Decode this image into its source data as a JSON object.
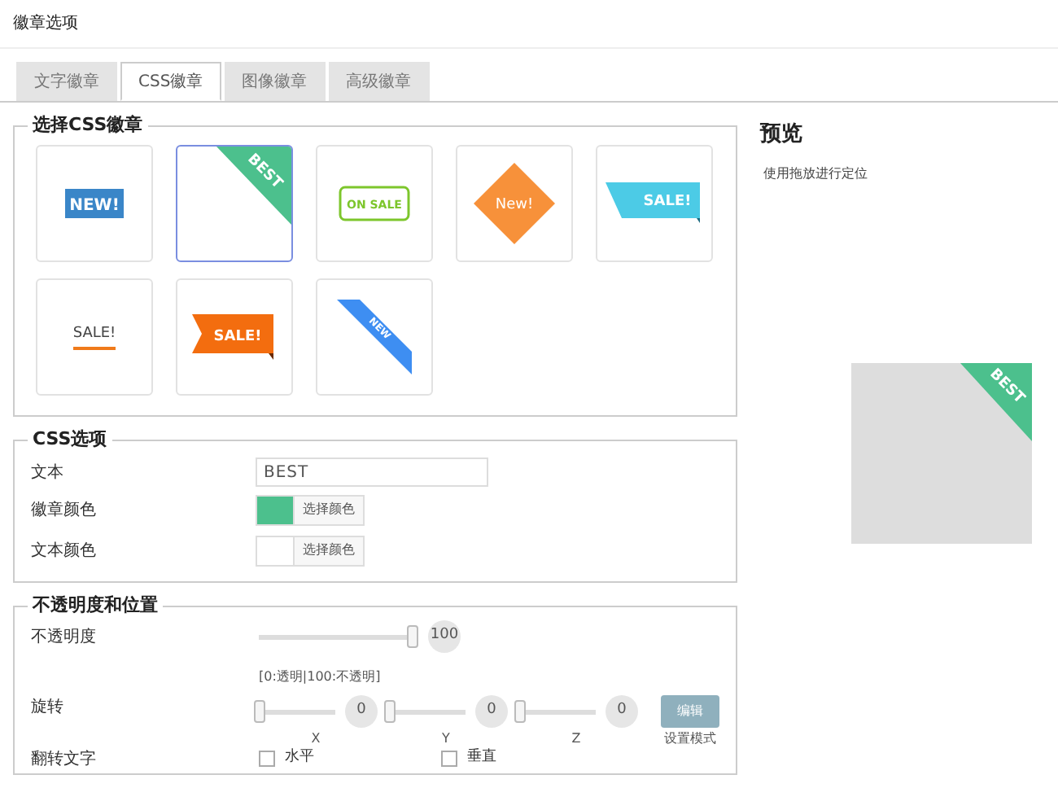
{
  "title": "徽章选项",
  "tabs": [
    {
      "label": "文字徽章",
      "selected": false
    },
    {
      "label": "CSS徽章",
      "selected": true
    },
    {
      "label": "图像徽章",
      "selected": false
    },
    {
      "label": "高级徽章",
      "selected": false
    }
  ],
  "badge_section": {
    "legend": "选择CSS徽章",
    "badges": [
      {
        "kind": "rect",
        "text": "NEW!",
        "color": "#3a86c8",
        "selected": false
      },
      {
        "kind": "corner",
        "text": "BEST",
        "color": "#4cc08d",
        "selected": true
      },
      {
        "kind": "outline",
        "text": "ON SALE",
        "color": "#7dc62c",
        "selected": false
      },
      {
        "kind": "diamond",
        "text": "New!",
        "color": "#f7913a",
        "selected": false
      },
      {
        "kind": "flag",
        "text": "SALE!",
        "color": "#4ccbe6",
        "selected": false
      },
      {
        "kind": "underline",
        "text": "SALE!",
        "color": "#f07a1a",
        "selected": false
      },
      {
        "kind": "arrow",
        "text": "SALE!",
        "color": "#f36d0f",
        "selected": false
      },
      {
        "kind": "ribbon",
        "text": "NEW",
        "color": "#3e8ef2",
        "selected": false
      }
    ]
  },
  "css_options": {
    "legend": "CSS选项",
    "text_label": "文本",
    "text_value": "BEST",
    "colors": [
      {
        "label": "徽章颜色",
        "color": "#4cc08d",
        "button": "选择颜色"
      },
      {
        "label": "文本颜色",
        "color": "#ffffff",
        "button": "选择颜色"
      }
    ]
  },
  "position": {
    "legend": "不透明度和位置",
    "opacity": {
      "label": "不透明度",
      "level": 1,
      "value": "100",
      "hint": "[0:透明|100:不透明]"
    },
    "rotation": {
      "label": "旋转",
      "sliders": [
        {
          "axis": "X",
          "level": 0,
          "value": "0"
        },
        {
          "axis": "Y",
          "level": 0,
          "value": "0"
        },
        {
          "axis": "Z",
          "level": 0,
          "value": "0"
        }
      ],
      "button": "编辑",
      "button_caption": "设置模式"
    },
    "flip": {
      "label": "翻转文字",
      "options": [
        {
          "label": "水平",
          "checked": false
        },
        {
          "label": "垂直",
          "checked": false
        }
      ]
    }
  },
  "preview": {
    "title": "预览",
    "hint": "使用拖放进行定位",
    "badge_text": "BEST"
  }
}
